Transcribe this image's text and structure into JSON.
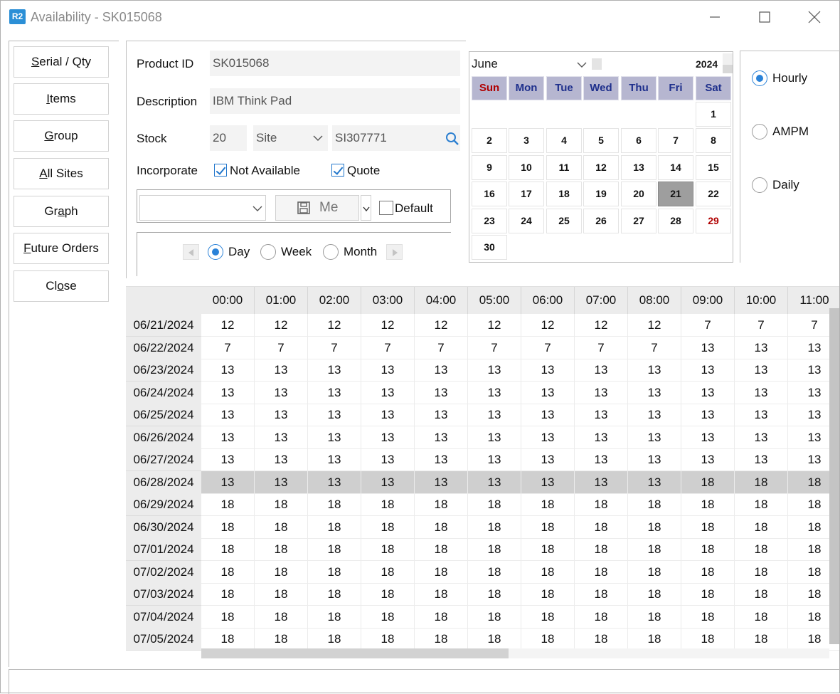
{
  "window": {
    "logo": "R2",
    "title": "Availability - SK015068"
  },
  "sidebar": {
    "items": [
      {
        "pre": "",
        "u": "S",
        "post": "erial / Qty"
      },
      {
        "pre": "",
        "u": "I",
        "post": "tems"
      },
      {
        "pre": "",
        "u": "G",
        "post": "roup"
      },
      {
        "pre": "",
        "u": "A",
        "post": "ll Sites"
      },
      {
        "pre": "Gr",
        "u": "a",
        "post": "ph"
      },
      {
        "pre": "",
        "u": "F",
        "post": "uture Orders"
      },
      {
        "pre": "Cl",
        "u": "o",
        "post": "se"
      }
    ]
  },
  "form": {
    "product_id_label": "Product ID",
    "product_id": "SK015068",
    "description_label": "Description",
    "description": "IBM Think Pad",
    "stock_label": "Stock",
    "stock_value": "20",
    "stock_type": "Site",
    "stock_site": "SI307771",
    "incorporate_label": "Incorporate",
    "not_available_label": "Not Available",
    "not_available_checked": true,
    "quote_label": "Quote",
    "quote_checked": true,
    "layout_select": "",
    "save_label": "Me",
    "default_label": "Default",
    "default_checked": false,
    "period_options": [
      "Day",
      "Week",
      "Month"
    ],
    "period_selected": "Day"
  },
  "calendar": {
    "month": "June",
    "year": "2024",
    "weekdays": [
      "Sun",
      "Mon",
      "Tue",
      "Wed",
      "Thu",
      "Fri",
      "Sat"
    ],
    "days": [
      "1",
      "2",
      "3",
      "4",
      "5",
      "6",
      "7",
      "8",
      "9",
      "10",
      "11",
      "12",
      "13",
      "14",
      "15",
      "16",
      "17",
      "18",
      "19",
      "20",
      "21",
      "22",
      "23",
      "24",
      "25",
      "26",
      "27",
      "28",
      "29",
      "30"
    ],
    "first_weekday_index": 6,
    "selected_day": "21",
    "highlight_day": "29",
    "sunday_color": "#b00000",
    "weekday_color": "#1e2f8c",
    "selected_bg": "#9e9e9e"
  },
  "mode": {
    "options": [
      "Hourly",
      "AMPM",
      "Daily"
    ],
    "selected": "Hourly"
  },
  "grid": {
    "columns": [
      "00:00",
      "01:00",
      "02:00",
      "03:00",
      "04:00",
      "05:00",
      "06:00",
      "07:00",
      "08:00",
      "09:00",
      "10:00",
      "11:00"
    ],
    "selected_row": "06/28/2024",
    "rows": [
      {
        "date": "06/21/2024",
        "values": [
          "12",
          "12",
          "12",
          "12",
          "12",
          "12",
          "12",
          "12",
          "12",
          "7",
          "7",
          "7"
        ]
      },
      {
        "date": "06/22/2024",
        "values": [
          "7",
          "7",
          "7",
          "7",
          "7",
          "7",
          "7",
          "7",
          "7",
          "13",
          "13",
          "13"
        ]
      },
      {
        "date": "06/23/2024",
        "values": [
          "13",
          "13",
          "13",
          "13",
          "13",
          "13",
          "13",
          "13",
          "13",
          "13",
          "13",
          "13"
        ]
      },
      {
        "date": "06/24/2024",
        "values": [
          "13",
          "13",
          "13",
          "13",
          "13",
          "13",
          "13",
          "13",
          "13",
          "13",
          "13",
          "13"
        ]
      },
      {
        "date": "06/25/2024",
        "values": [
          "13",
          "13",
          "13",
          "13",
          "13",
          "13",
          "13",
          "13",
          "13",
          "13",
          "13",
          "13"
        ]
      },
      {
        "date": "06/26/2024",
        "values": [
          "13",
          "13",
          "13",
          "13",
          "13",
          "13",
          "13",
          "13",
          "13",
          "13",
          "13",
          "13"
        ]
      },
      {
        "date": "06/27/2024",
        "values": [
          "13",
          "13",
          "13",
          "13",
          "13",
          "13",
          "13",
          "13",
          "13",
          "13",
          "13",
          "13"
        ]
      },
      {
        "date": "06/28/2024",
        "values": [
          "13",
          "13",
          "13",
          "13",
          "13",
          "13",
          "13",
          "13",
          "13",
          "18",
          "18",
          "18"
        ]
      },
      {
        "date": "06/29/2024",
        "values": [
          "18",
          "18",
          "18",
          "18",
          "18",
          "18",
          "18",
          "18",
          "18",
          "18",
          "18",
          "18"
        ]
      },
      {
        "date": "06/30/2024",
        "values": [
          "18",
          "18",
          "18",
          "18",
          "18",
          "18",
          "18",
          "18",
          "18",
          "18",
          "18",
          "18"
        ]
      },
      {
        "date": "07/01/2024",
        "values": [
          "18",
          "18",
          "18",
          "18",
          "18",
          "18",
          "18",
          "18",
          "18",
          "18",
          "18",
          "18"
        ]
      },
      {
        "date": "07/02/2024",
        "values": [
          "18",
          "18",
          "18",
          "18",
          "18",
          "18",
          "18",
          "18",
          "18",
          "18",
          "18",
          "18"
        ]
      },
      {
        "date": "07/03/2024",
        "values": [
          "18",
          "18",
          "18",
          "18",
          "18",
          "18",
          "18",
          "18",
          "18",
          "18",
          "18",
          "18"
        ]
      },
      {
        "date": "07/04/2024",
        "values": [
          "18",
          "18",
          "18",
          "18",
          "18",
          "18",
          "18",
          "18",
          "18",
          "18",
          "18",
          "18"
        ]
      },
      {
        "date": "07/05/2024",
        "values": [
          "18",
          "18",
          "18",
          "18",
          "18",
          "18",
          "18",
          "18",
          "18",
          "18",
          "18",
          "18"
        ]
      }
    ]
  }
}
